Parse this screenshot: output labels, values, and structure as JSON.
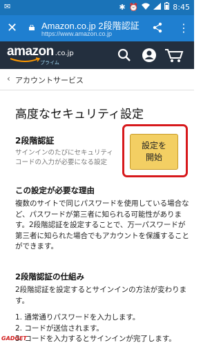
{
  "status_bar": {
    "time": "8:45",
    "icons": [
      "bluetooth-icon",
      "alarm-icon",
      "wifi-icon",
      "signal-icon",
      "battery-icon"
    ]
  },
  "browser": {
    "title": "Amazon.co.jp 2段階認証",
    "url": "https://www.amazon.co.jp",
    "icons": [
      "close-icon",
      "lock-icon",
      "share-icon",
      "menu-icon"
    ]
  },
  "amazon_header": {
    "logo_text": "amazon",
    "logo_domain": ".co.jp",
    "logo_sub": "プライム",
    "icons": [
      "search-icon",
      "account-icon",
      "cart-icon"
    ]
  },
  "breadcrumb": {
    "label": "アカウントサービス"
  },
  "page": {
    "title": "高度なセキュリティ設定",
    "twofa": {
      "title": "2段階認証",
      "desc": "サインインのたびにセキュリティコードの入力が必要になる設定",
      "button_line1": "設定を",
      "button_line2": "開始"
    },
    "why": {
      "title": "この設定が必要な理由",
      "body": "複数のサイトで同じパスワードを使用している場合など、パスワードが第三者に知られる可能性があります。2段階認証を設定することで、万一パスワードが第三者に知られた場合でもアカウントを保護することができます。"
    },
    "how": {
      "title": "2段階認証の仕組み",
      "body": "2段階認証を設定するとサインインの方法が変わります。",
      "steps": [
        "1. 通常通りパスワードを入力します。",
        "2. コードが送信されます。",
        "3. コードを入力するとサインインが完了します。"
      ]
    }
  },
  "watermark": "GADGET"
}
